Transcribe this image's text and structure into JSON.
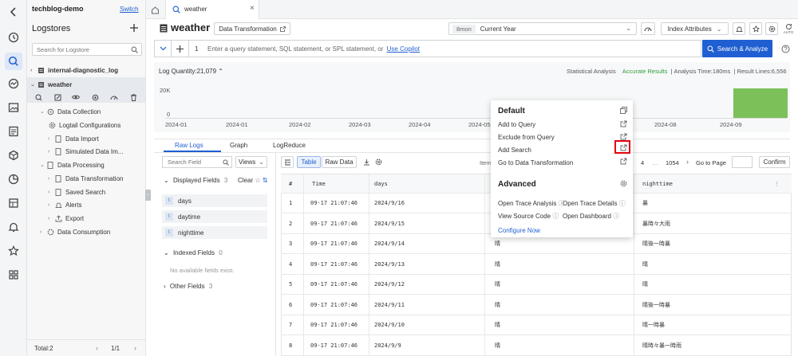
{
  "project": {
    "name": "techblog-demo",
    "switch_label": "Switch"
  },
  "sidebar": {
    "title": "Logstores",
    "search_placeholder": "Search for Logstore",
    "stores": [
      {
        "name": "internal-diagnostic_log"
      },
      {
        "name": "weather"
      }
    ],
    "tree": {
      "data_collection": "Data Collection",
      "logtail": "Logtail Configurations",
      "data_import": "Data Import",
      "simulated": "Simulated Data Im...",
      "data_processing": "Data Processing",
      "data_transformation": "Data Transformation",
      "saved_search": "Saved Search",
      "alerts": "Alerts",
      "export": "Export",
      "data_consumption": "Data Consumption"
    },
    "footer": {
      "total": "Total:2",
      "page": "1/1"
    }
  },
  "tab": {
    "label": "weather"
  },
  "header": {
    "title": "weather",
    "data_transformation_label": "Data Transformation",
    "time_badge": "8mon",
    "time_value": "Current Year",
    "index_attributes": "Index Attributes",
    "auto_label": "AUTO"
  },
  "query": {
    "line_no": "1",
    "placeholder": "Enter a query statement, SQL statement, or SPL statement, or",
    "copilot_link": "Use Copilot",
    "search_label": "Search & Analyze"
  },
  "histogram": {
    "label": "Log Quantity:21,079",
    "statistical": "Statistical Analysis",
    "accurate": "Accurate Results",
    "time": "Analysis Time:180ms",
    "lines": "Result Lines:6,556",
    "y_top": "20K",
    "y_zero": "0",
    "x_labels": [
      "2024-01",
      "2024-01",
      "2024-02",
      "2024-03",
      "2024-04",
      "2024-05",
      "2024-08",
      "2024-09"
    ]
  },
  "results_tabs": [
    "Raw Logs",
    "Graph",
    "LogReduce"
  ],
  "fields": {
    "search_placeholder": "Search Field",
    "views_label": "Views",
    "displayed_label": "Displayed Fields",
    "displayed_count": "3",
    "clear_label": "Clear",
    "displayed": [
      "days",
      "daytime",
      "nighttime"
    ],
    "indexed_label": "Indexed Fields",
    "indexed_count": "0",
    "no_fields": "No available fields exist.",
    "other_label": "Other Fields",
    "other_count": "3"
  },
  "toolbar": {
    "table_label": "Table",
    "raw_label": "Raw Data",
    "items_label": "Item",
    "page_current": "4",
    "page_total": "1054",
    "goto_label": "Go to Page",
    "confirm_label": "Confirm"
  },
  "table": {
    "headers": [
      "#",
      "Time",
      "days",
      "",
      "nighttime"
    ],
    "rows": [
      {
        "n": "1",
        "time": "09-17 21:07:46",
        "days": "2024/9/16",
        "daytime": "",
        "night": "暴"
      },
      {
        "n": "2",
        "time": "09-17 21:07:46",
        "days": "2024/9/15",
        "daytime": "",
        "night": "暴時々大雨"
      },
      {
        "n": "3",
        "time": "09-17 21:07:46",
        "days": "2024/9/14",
        "daytime": "晴",
        "night": "晴後一時暴"
      },
      {
        "n": "4",
        "time": "09-17 21:07:46",
        "days": "2024/9/13",
        "daytime": "晴",
        "night": "晴"
      },
      {
        "n": "5",
        "time": "09-17 21:07:46",
        "days": "2024/9/12",
        "daytime": "晴",
        "night": "晴"
      },
      {
        "n": "6",
        "time": "09-17 21:07:46",
        "days": "2024/9/11",
        "daytime": "晴",
        "night": "晴後一時暴"
      },
      {
        "n": "7",
        "time": "09-17 21:07:46",
        "days": "2024/9/10",
        "daytime": "晴",
        "night": "晴一時暴"
      },
      {
        "n": "8",
        "time": "09-17 21:07:46",
        "days": "2024/9/9",
        "daytime": "晴",
        "night": "晴時々暴一時雨"
      }
    ]
  },
  "popup": {
    "default_title": "Default",
    "items": [
      "Add to Query",
      "Exclude from Query",
      "Add Search",
      "Go to Data Transformation"
    ],
    "advanced_title": "Advanced",
    "advanced": [
      "Open Trace Analysis",
      "Open Trace Details",
      "View Source Code",
      "Open Dashboard"
    ],
    "configure": "Configure Now"
  },
  "colors": {
    "accent": "#1f5fd1",
    "success": "#2e9e3a",
    "highlight": "#e3000f",
    "bar": "#7cc05a"
  }
}
